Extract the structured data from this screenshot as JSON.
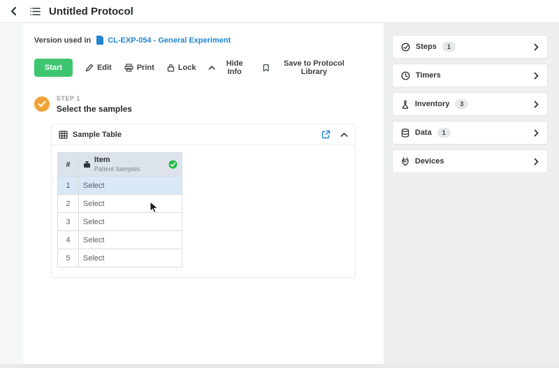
{
  "colors": {
    "start_green": "#3ec56f",
    "link_blue": "#2185d0",
    "step_orange": "#f0a336",
    "check_green": "#21ba45",
    "table_header_bg": "#dde3ea",
    "selected_row_bg": "#d9e8f6",
    "sidebar_bg": "#eef0f0"
  },
  "header": {
    "title": "Untitled Protocol"
  },
  "main": {
    "version_label": "Version used in",
    "version_link": "CL-EXP-054 - General Experiment",
    "toolbar": {
      "start": "Start",
      "edit": "Edit",
      "print": "Print",
      "lock": "Lock",
      "hide_info": "Hide Info",
      "save_library": "Save to Protocol Library"
    },
    "step": {
      "label": "STEP 1",
      "title": "Select the samples"
    },
    "sample_table": {
      "title": "Sample Table",
      "col_num": "#",
      "col_item": "Item",
      "col_item_sub": "Patient Samples",
      "rows": [
        {
          "num": "1",
          "value": "Select"
        },
        {
          "num": "2",
          "value": "Select"
        },
        {
          "num": "3",
          "value": "Select"
        },
        {
          "num": "4",
          "value": "Select"
        },
        {
          "num": "5",
          "value": "Select"
        }
      ]
    }
  },
  "sidebar": {
    "items": [
      {
        "label": "Steps",
        "count": "1"
      },
      {
        "label": "Timers",
        "count": ""
      },
      {
        "label": "Inventory",
        "count": "3"
      },
      {
        "label": "Data",
        "count": "1"
      },
      {
        "label": "Devices",
        "count": ""
      }
    ]
  }
}
